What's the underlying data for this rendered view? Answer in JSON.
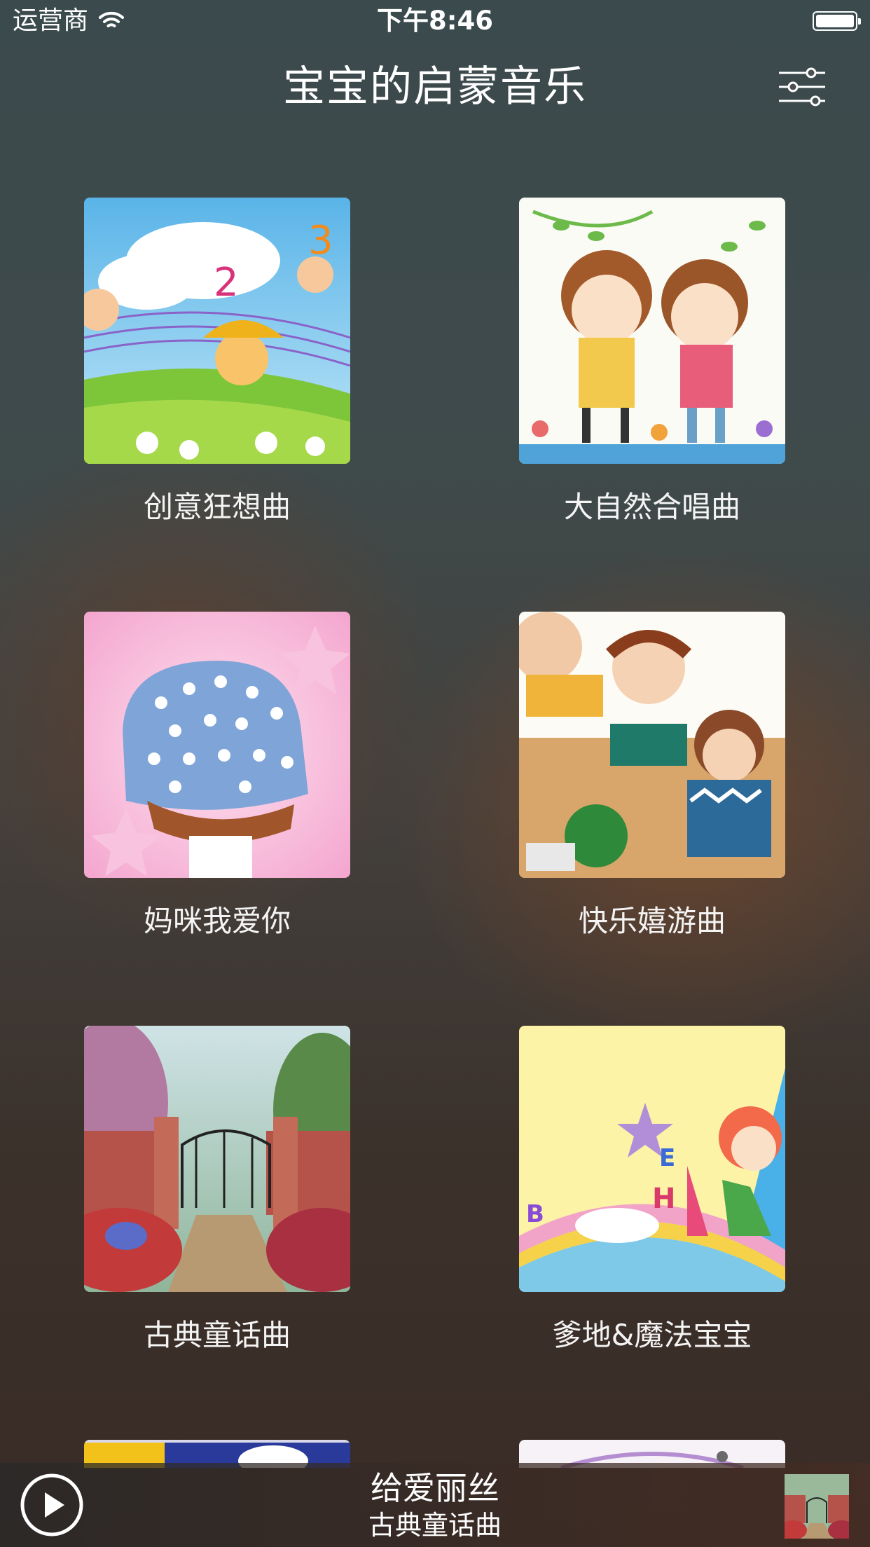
{
  "status_bar": {
    "carrier": "运营商",
    "time": "下午8:46",
    "icons": [
      "wifi-icon",
      "battery-icon"
    ]
  },
  "nav": {
    "title": "宝宝的启蒙音乐",
    "settings_icon": "sliders-icon"
  },
  "albums": [
    {
      "title": "创意狂想曲"
    },
    {
      "title": "大自然合唱曲"
    },
    {
      "title": "妈咪我爱你"
    },
    {
      "title": "快乐嬉游曲"
    },
    {
      "title": "古典童话曲"
    },
    {
      "title": "爹地&魔法宝宝"
    }
  ],
  "now_playing": {
    "title": "给爱丽丝",
    "album": "古典童话曲",
    "play_icon": "play-icon"
  }
}
